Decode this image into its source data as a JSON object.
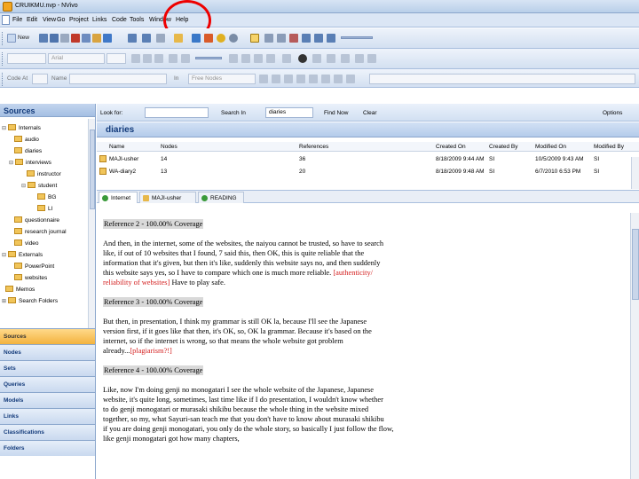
{
  "window": {
    "title": "CRUIKMU.nvp - NVivo"
  },
  "menu": [
    "File",
    "Edit",
    "View",
    "Go",
    "Project",
    "Links",
    "Code",
    "Tools",
    "Window",
    "Help"
  ],
  "toolbar1": {
    "new_label": "New"
  },
  "toolbar2": {
    "font": "Arial"
  },
  "toolbar3": {
    "code_at_label": "Code At",
    "name_label": "Name",
    "in_label": "In",
    "in_value": "Free Nodes"
  },
  "sidebar": {
    "title": "Sources",
    "tree": [
      "Internals",
      "audio",
      "diaries",
      "interviews",
      "instructor",
      "student",
      "BG",
      "LI",
      "questionnaire",
      "research journal",
      "video",
      "Externals",
      "PowerPoint",
      "websites",
      "Memos",
      "Search Folders"
    ],
    "nav_buttons": [
      "Sources",
      "Nodes",
      "Sets",
      "Queries",
      "Models",
      "Links",
      "Classifications",
      "Folders"
    ]
  },
  "find": {
    "look_for_label": "Look for:",
    "search_in_label": "Search In",
    "search_in_value": "diaries",
    "find_now": "Find Now",
    "clear": "Clear",
    "options": "Options"
  },
  "list": {
    "title": "diaries",
    "columns": [
      "Name",
      "Nodes",
      "References",
      "Created On",
      "Created By",
      "Modified On",
      "Modified By"
    ],
    "rows": [
      [
        "MAJI-usher",
        "14",
        "36",
        "8/18/2009 9:44 AM",
        "SI",
        "10/5/2009 9:43 AM",
        "SI"
      ],
      [
        "WA-diary2",
        "13",
        "20",
        "8/18/2009 9:48 AM",
        "SI",
        "6/7/2010 6:53 PM",
        "SI"
      ]
    ]
  },
  "tabs": [
    "Internet",
    "MAJI-usher",
    "READING"
  ],
  "content": {
    "ref1": "Reference 2 - 100.00% Coverage",
    "p1": [
      "And then, in the internet, some of the websites, the naiyou cannot be trusted, so have to search",
      "like, if out of 10 websites that I found, 7 said this, then OK, this is quite reliable that the",
      "information that it's given, but then it's like, suddenly this website says no, and then suddenly",
      "this website says yes, so I have to compare which one is much more reliable."
    ],
    "p1_red1": " [authenticity/",
    "p1_red2": "reliability of websites]",
    "p1_end": " Have to play safe.",
    "ref2": "Reference 3 - 100.00% Coverage",
    "p2": [
      "But then, in presentation, I think my grammar is still OK la, because I'll see the Japanese",
      "version first, if it goes like that then, it's OK, so, OK la grammar. Because it's based on the",
      "internet, so if the internet is wrong, so that means the whole website got problem",
      "already..."
    ],
    "p2_red": "[plagiarism?!]",
    "ref3": "Reference 4 - 100.00% Coverage",
    "p3": [
      "Like, now I'm doing genji no monogatari I see the whole website of the Japanese, Japanese",
      "website, it's quite long, sometimes, last time like if I do presentation, I wouldn't know whether",
      "to do genji monogatari or murasaki shikibu because the whole thing in the website mixed",
      "together, so my, what Sayuri-san teach me that you don't have to know about murasaki shikibu",
      "if you are doing genji monogatari, you only do the whole story, so basically I just follow the flow,",
      "like genji monogatari got how many chapters,"
    ]
  }
}
